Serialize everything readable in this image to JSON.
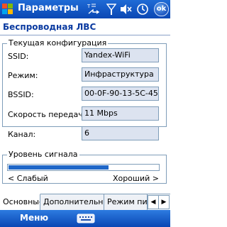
{
  "titlebar": {
    "title": "Параметры",
    "ok_label": "ok"
  },
  "page_title": "Беспроводная ЛВС",
  "config_group": {
    "legend": "Текущая конфигурация",
    "fields": [
      {
        "label": "SSID:",
        "value": "Yandex-WiFi"
      },
      {
        "label": "Режим:",
        "value": "Инфраструктура"
      },
      {
        "label": "BSSID:",
        "value": "00-0F-90-13-5C-45"
      },
      {
        "label": "Скорость передачи:",
        "value": "11 Mbps"
      },
      {
        "label": "Канал:",
        "value": "6"
      }
    ]
  },
  "signal_group": {
    "legend": "Уровень сигнала",
    "level": 0.67,
    "low_label": "< Слабый",
    "high_label": "Хороший >"
  },
  "tabs": [
    "Основные",
    "Дополнительно",
    "Режим питания"
  ],
  "menubar": {
    "menu_label": "Меню"
  },
  "colors": {
    "titlebar": "#0a47b4",
    "accent_text": "#0a3aa0",
    "field_bg": "#dce3f0",
    "signal_fill": "#1f67c8"
  }
}
